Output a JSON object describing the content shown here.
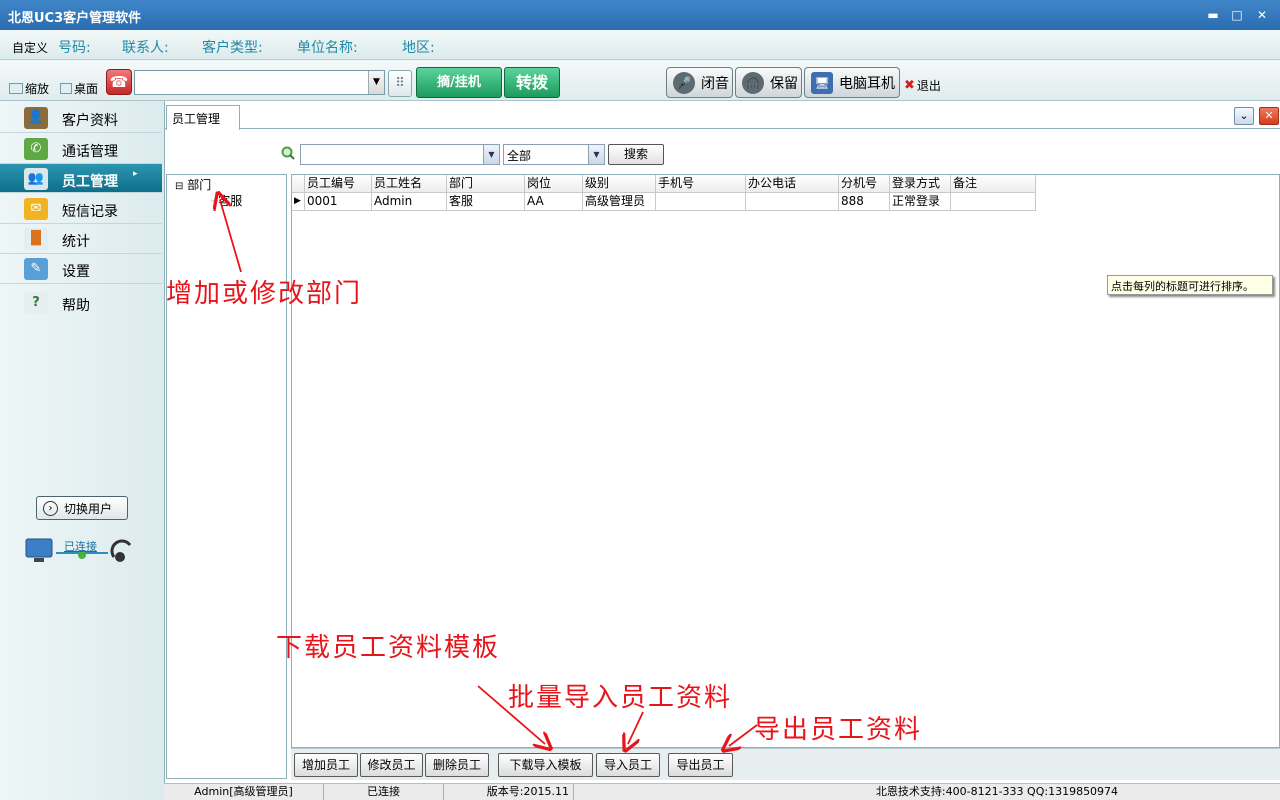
{
  "window": {
    "title": "北恩UC3客户管理软件"
  },
  "infobar": {
    "customize": "自定义",
    "fields": [
      "号码:",
      "联系人:",
      "客户类型:",
      "单位名称:",
      "地区:"
    ]
  },
  "toolbar": {
    "zoom_label": "缩放",
    "desktop_label": "桌面",
    "dial_hangup_label": "摘/挂机",
    "transfer_label": "转拨",
    "mute_label": "闭音",
    "hold_label": "保留",
    "pc_headset_label": "电脑耳机",
    "exit_label": "退出"
  },
  "sidebar": {
    "items": [
      {
        "label": "客户资料",
        "icon": "customer-profile-icon",
        "active": false
      },
      {
        "label": "通话管理",
        "icon": "call-management-icon",
        "active": false
      },
      {
        "label": "员工管理",
        "icon": "staff-management-icon",
        "active": true
      },
      {
        "label": "短信记录",
        "icon": "envelope-icon",
        "active": false
      },
      {
        "label": "统计",
        "icon": "bar-chart-icon",
        "active": false
      },
      {
        "label": "设置",
        "icon": "settings-icon",
        "active": false
      },
      {
        "label": "帮助",
        "icon": "help-icon",
        "active": false
      }
    ],
    "switch_user_label": "切换用户",
    "connection_status": "已连接"
  },
  "main": {
    "tab_label": "员工管理",
    "search": {
      "input_value": "",
      "select_value": "全部",
      "button_label": "搜索"
    },
    "tree": {
      "root": "部门",
      "child": "客服"
    },
    "grid": {
      "columns": [
        "员工编号",
        "员工姓名",
        "部门",
        "岗位",
        "级别",
        "手机号",
        "办公电话",
        "分机号",
        "登录方式",
        "备注"
      ],
      "rows": [
        [
          "0001",
          "Admin",
          "客服",
          "AA",
          "高级管理员",
          "",
          "",
          "888",
          "正常登录",
          ""
        ]
      ]
    },
    "tooltip": "点击每列的标题可进行排序。",
    "buttons": {
      "add": "增加员工",
      "edit": "修改员工",
      "delete": "删除员工",
      "download_template": "下载导入模板",
      "import": "导入员工",
      "export": "导出员工"
    }
  },
  "statusbar": {
    "user": "Admin[高级管理员]",
    "connection": "已连接",
    "version": "版本号:2015.11",
    "support": "北恩技术支持:400-8121-333 QQ:1319850974"
  },
  "annotations": {
    "department": "增加或修改部门",
    "download_template": "下载员工资料模板",
    "batch_import": "批量导入员工资料",
    "export": "导出员工资料"
  },
  "colors": {
    "accent": "#1d83a0",
    "annotation": "#e8141a",
    "titlebar": "#3179bd"
  }
}
